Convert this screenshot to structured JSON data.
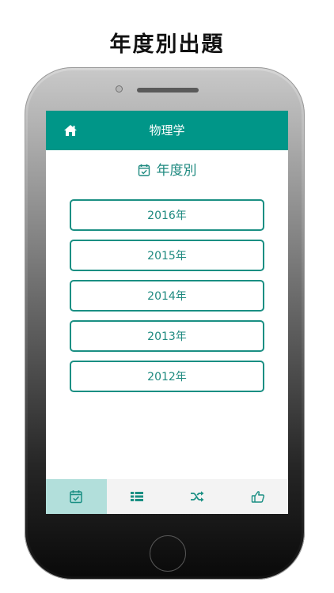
{
  "headline": "年度別出題",
  "app": {
    "title": "物理学",
    "home_icon": "home-icon"
  },
  "section": {
    "title": "年度別",
    "icon": "calendar-check-icon"
  },
  "years": [
    "2016年",
    "2015年",
    "2014年",
    "2013年",
    "2012年"
  ],
  "tabbar": {
    "items": [
      {
        "icon": "calendar-check-icon",
        "active": true
      },
      {
        "icon": "list-icon",
        "active": false
      },
      {
        "icon": "shuffle-icon",
        "active": false
      },
      {
        "icon": "thumbs-up-icon",
        "active": false
      }
    ]
  },
  "colors": {
    "accent": "#009688",
    "accent_text": "#1f8a80",
    "active_tab": "#b2dfdb",
    "tabbar_bg": "#f3f3f3"
  }
}
